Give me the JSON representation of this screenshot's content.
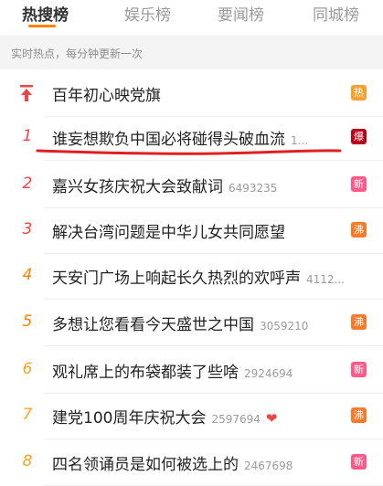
{
  "tabs": [
    {
      "label": "热搜榜"
    },
    {
      "label": "娱乐榜"
    },
    {
      "label": "要闻榜"
    },
    {
      "label": "同城榜"
    }
  ],
  "subtitle": "实时热点，每分钟更新一次",
  "colors": {
    "accent": "#ff8200",
    "rank_red": "#f24444",
    "rank_orange": "#ff8200",
    "rank_yellow": "#f5a623",
    "badge_hot": "#f9a130",
    "badge_explode": "#b9061c",
    "badge_new": "#ff5a8b",
    "badge_boil": "#f87a2a",
    "underline_red": "#e02020"
  },
  "rows": [
    {
      "rank": "",
      "rank_icon": "pin-top-icon",
      "title": "百年初心映党旗",
      "count": "",
      "badge": "热"
    },
    {
      "rank": "1",
      "title": "谁妄想欺负中国必将碰得头破血流",
      "count": "1...",
      "badge": "爆"
    },
    {
      "rank": "2",
      "title": "嘉兴女孩庆祝大会致献词",
      "count": "6493235",
      "badge": "新"
    },
    {
      "rank": "3",
      "title": "解决台湾问题是中华儿女共同愿望",
      "count": "",
      "badge": "沸"
    },
    {
      "rank": "4",
      "title": "天安门广场上响起长久热烈的欢呼声",
      "count": "4112...",
      "badge": ""
    },
    {
      "rank": "5",
      "title": "多想让您看看今天盛世之中国",
      "count": "3059210",
      "badge": "沸"
    },
    {
      "rank": "6",
      "title": "观礼席上的布袋都装了些啥",
      "count": "2924694",
      "badge": "新"
    },
    {
      "rank": "7",
      "title": "建党100周年庆祝大会",
      "count": "2597694",
      "badge": "沸",
      "extra_icon": "heart-icon"
    },
    {
      "rank": "8",
      "title": "四名领诵员是如何被选上的",
      "count": "2467698",
      "badge": "新"
    }
  ]
}
